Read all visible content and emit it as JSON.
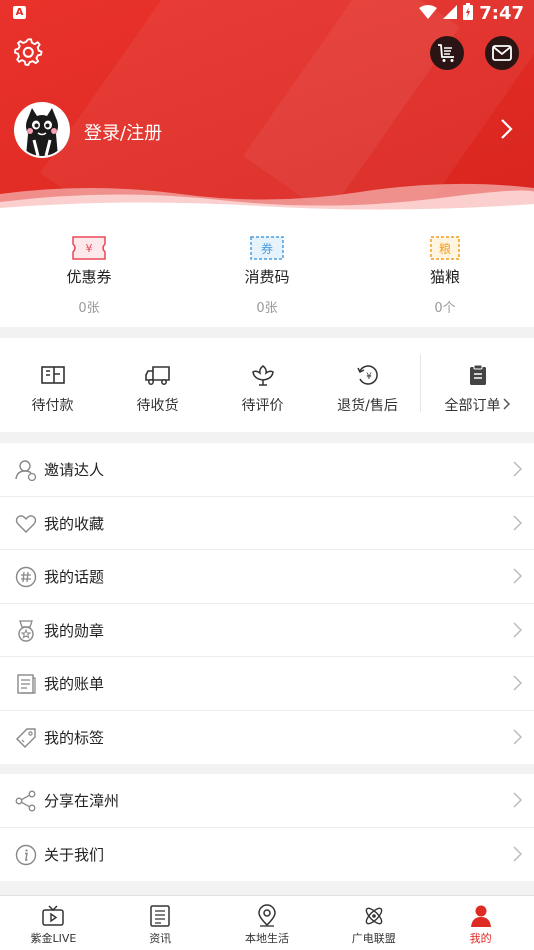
{
  "status_bar": {
    "left_badge": "A",
    "time": "7:47"
  },
  "profile": {
    "login_label": "登录/注册"
  },
  "stats": [
    {
      "label": "优惠券",
      "value": "0张",
      "icon": "coupon-icon",
      "icon_text": "¥",
      "color": "#e8485a"
    },
    {
      "label": "消费码",
      "value": "0张",
      "icon": "voucher-icon",
      "icon_text": "券",
      "color": "#4a9de0"
    },
    {
      "label": "猫粮",
      "value": "0个",
      "icon": "cat-food-icon",
      "icon_text": "粮",
      "color": "#f0a020"
    }
  ],
  "orders": [
    {
      "label": "待付款",
      "icon": "wallet-icon"
    },
    {
      "label": "待收货",
      "icon": "truck-icon"
    },
    {
      "label": "待评价",
      "icon": "flower-icon"
    },
    {
      "label": "退货/售后",
      "icon": "refund-icon"
    },
    {
      "label": "全部订单",
      "icon": "clipboard-icon"
    }
  ],
  "menu_primary": [
    {
      "label": "邀请达人",
      "icon": "invite-user-icon"
    },
    {
      "label": "我的收藏",
      "icon": "heart-icon"
    },
    {
      "label": "我的话题",
      "icon": "hashtag-icon"
    },
    {
      "label": "我的勋章",
      "icon": "medal-icon"
    },
    {
      "label": "我的账单",
      "icon": "bill-icon"
    },
    {
      "label": "我的标签",
      "icon": "tag-icon"
    }
  ],
  "menu_secondary": [
    {
      "label": "分享在漳州",
      "icon": "share-icon"
    },
    {
      "label": "关于我们",
      "icon": "info-icon"
    }
  ],
  "tabs": [
    {
      "label": "紫金LIVE",
      "icon": "tv-icon"
    },
    {
      "label": "资讯",
      "icon": "news-icon"
    },
    {
      "label": "本地生活",
      "icon": "location-icon"
    },
    {
      "label": "广电联盟",
      "icon": "atom-icon"
    },
    {
      "label": "我的",
      "icon": "user-icon",
      "active": true
    }
  ],
  "colors": {
    "brand_red": "#e02a24",
    "tab_active": "#e02a24"
  }
}
